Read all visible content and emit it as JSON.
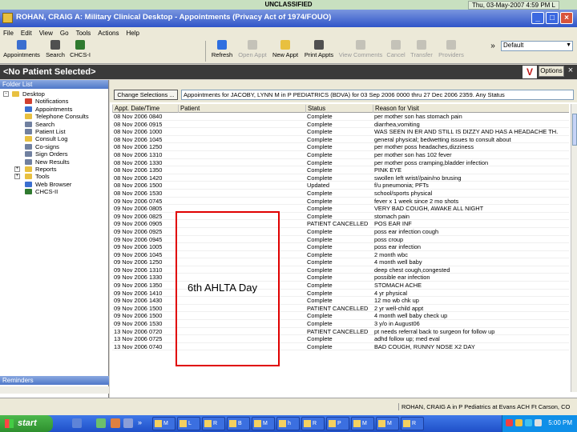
{
  "classification": {
    "banner": "UNCLASSIFIED",
    "datetime": "Thu, 03-May-2007 4:59 PM L"
  },
  "window": {
    "title": "ROHAN, CRAIG A: Military Clinical Desktop - Appointments (Privacy Act of 1974/FOUO)",
    "minimize": "_",
    "maximize": "□",
    "close": "×"
  },
  "menu": [
    "File",
    "Edit",
    "View",
    "Go",
    "Tools",
    "Actions",
    "Help"
  ],
  "toolbar": {
    "left_buttons": [
      {
        "label": "Appointments",
        "icon": "appointments-icon",
        "color": "#3b6fd0"
      },
      {
        "label": "Search",
        "icon": "search-icon",
        "color": "#505050"
      },
      {
        "label": "CHCS-I",
        "icon": "chcs-icon",
        "color": "#2f7a2f"
      }
    ],
    "right_buttons": [
      {
        "label": "Refresh",
        "icon": "refresh-icon",
        "color": "#2f6fe0",
        "enabled": true
      },
      {
        "label": "Open Appt",
        "icon": "open-appt-icon",
        "color": "#999",
        "enabled": false
      },
      {
        "label": "New Appt",
        "icon": "new-appt-icon",
        "color": "#e8c040",
        "enabled": true
      },
      {
        "label": "Print Appts",
        "icon": "print-icon",
        "color": "#505050",
        "enabled": true
      },
      {
        "label": "View Comments",
        "icon": "comments-icon",
        "color": "#999",
        "enabled": false
      },
      {
        "label": "Cancel",
        "icon": "cancel-icon",
        "color": "#999",
        "enabled": false
      },
      {
        "label": "Transfer",
        "icon": "transfer-icon",
        "color": "#999",
        "enabled": false
      },
      {
        "label": "Providers",
        "icon": "providers-icon",
        "color": "#999",
        "enabled": false
      }
    ],
    "overflow": "»",
    "profile_select": "Default"
  },
  "patient_bar": {
    "text": "<No Patient Selected>",
    "options_label": "Options",
    "close": "×"
  },
  "folder_list": {
    "header": "Folder List",
    "items": [
      {
        "label": "Desktop",
        "level": 0,
        "expander": "-",
        "color": "#e8c040"
      },
      {
        "label": "Notifications",
        "level": 1,
        "color": "#d04030"
      },
      {
        "label": "Appointments",
        "level": 1,
        "color": "#3b6fd0"
      },
      {
        "label": "Telephone Consults",
        "level": 1,
        "color": "#e8c040"
      },
      {
        "label": "Search",
        "level": 1,
        "color": "#7080a0"
      },
      {
        "label": "Patient List",
        "level": 1,
        "color": "#7080a0"
      },
      {
        "label": "Consult Log",
        "level": 1,
        "color": "#e8c040"
      },
      {
        "label": "Co-signs",
        "level": 1,
        "color": "#7080a0"
      },
      {
        "label": "Sign Orders",
        "level": 1,
        "color": "#7080a0"
      },
      {
        "label": "New Results",
        "level": 1,
        "color": "#7080a0"
      },
      {
        "label": "Reports",
        "level": 1,
        "expander": "+",
        "color": "#e8c040"
      },
      {
        "label": "Tools",
        "level": 1,
        "expander": "+",
        "color": "#e8c040"
      },
      {
        "label": "Web Browser",
        "level": 1,
        "color": "#3b6fd0"
      },
      {
        "label": "CHCS-II",
        "level": 1,
        "color": "#2f7a2f"
      }
    ],
    "reminders_header": "Reminders"
  },
  "appointments": {
    "change_selections": "Change Selections ...",
    "info": "Appointments for JACOBY, LYNN M in P PEDIATRICS (BDVA) for 03 Sep 2006 0000 thru 27 Dec 2006 2359. Any Status",
    "columns": [
      "Appt. Date/Time",
      "Patient",
      "Status",
      "Reason for Visit"
    ],
    "rows": [
      [
        "08 Nov 2006 0840",
        "",
        "Complete",
        "per mother son has stomach pain"
      ],
      [
        "08 Nov 2006 0915",
        "",
        "Complete",
        "diarrhea,vomiting"
      ],
      [
        "08 Nov 2006 1000",
        "",
        "Complete",
        "WAS SEEN IN ER AND STILL IS DIZZY AND HAS A HEADACHE TH."
      ],
      [
        "08 Nov 2006 1045",
        "",
        "Complete",
        "general physical; bedwetting issues to consult about"
      ],
      [
        "08 Nov 2006 1250",
        "",
        "Complete",
        "per mother poss headaches,dizziness"
      ],
      [
        "08 Nov 2006 1310",
        "",
        "Complete",
        "per mother son has 102 fever"
      ],
      [
        "08 Nov 2006 1330",
        "",
        "Complete",
        "per mother poss cramping,bladder infection"
      ],
      [
        "08 Nov 2006 1350",
        "",
        "Complete",
        "PINK EYE"
      ],
      [
        "08 Nov 2006 1420",
        "",
        "Complete",
        "swollen left wrist//pain/no brusing"
      ],
      [
        "08 Nov 2006 1500",
        "",
        "Updated",
        "f/u pneumonia; PFTs"
      ],
      [
        "08 Nov 2006 1530",
        "",
        "Complete",
        "school/sports physical"
      ],
      [
        "09 Nov 2006 0745",
        "",
        "Complete",
        "fever x 1 week since 2 mo shots"
      ],
      [
        "09 Nov 2006 0805",
        "",
        "Complete",
        "VERY BAD COUGH, AWAKE ALL NIGHT"
      ],
      [
        "09 Nov 2006 0825",
        "",
        "Complete",
        "stomach pain"
      ],
      [
        "09 Nov 2006 0905",
        "",
        "PATIENT CANCELLED",
        "POS EAR INF"
      ],
      [
        "09 Nov 2006 0925",
        "",
        "Complete",
        "poss ear infection cough"
      ],
      [
        "09 Nov 2006 0945",
        "",
        "Complete",
        "poss croup"
      ],
      [
        "09 Nov 2006 1005",
        "",
        "Complete",
        "poss ear infection"
      ],
      [
        "09 Nov 2006 1045",
        "",
        "Complete",
        "2 month wbc"
      ],
      [
        "09 Nov 2006 1250",
        "",
        "Complete",
        "4 month well baby"
      ],
      [
        "09 Nov 2006 1310",
        "",
        "Complete",
        "deep chest cough,congested"
      ],
      [
        "09 Nov 2006 1330",
        "",
        "Complete",
        "possible ear infection"
      ],
      [
        "09 Nov 2006 1350",
        "",
        "Complete",
        "STOMACH ACHE"
      ],
      [
        "09 Nov 2006 1410",
        "",
        "Complete",
        "4 yr physical"
      ],
      [
        "09 Nov 2006 1430",
        "",
        "Complete",
        "12 mo wb chk up"
      ],
      [
        "09 Nov 2006 1500",
        "",
        "PATIENT CANCELLED",
        "2 yr well-child appt"
      ],
      [
        "09 Nov 2006 1500",
        "",
        "Complete",
        "4 month well baby check up"
      ],
      [
        "09 Nov 2006 1530",
        "",
        "Complete",
        "3 y/o in August06"
      ],
      [
        "13 Nov 2006 0720",
        "",
        "PATIENT CANCELLED",
        "pt needs referral back to surgeon for follow up"
      ],
      [
        "13 Nov 2006 0725",
        "",
        "Complete",
        "adhd follow up; med eval"
      ],
      [
        "13 Nov 2006 0740",
        "",
        "Complete",
        "BAD COUGH, RUNNY NOSE X2 DAY"
      ]
    ],
    "annotation": "6th AHLTA Day"
  },
  "status_bar": {
    "text": "ROHAN, CRAIG A in P Pediatrics at Evans ACH Ft Carson, CO"
  },
  "taskbar": {
    "start": "start",
    "quicklaunch_overflow": "»",
    "tasks": [
      "M",
      "L",
      "R",
      "B",
      "M",
      "h",
      "R",
      "P",
      "M",
      "M",
      "R"
    ],
    "clock": "5:00 PM"
  }
}
